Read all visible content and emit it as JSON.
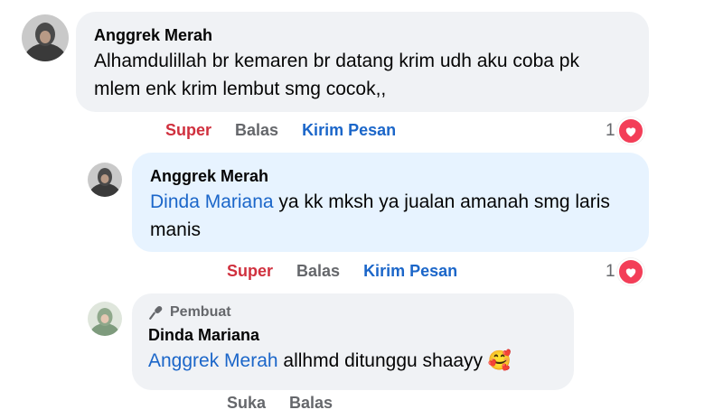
{
  "comments": [
    {
      "author": "Anggrek Merah",
      "text": "Alhamdulillah br kemaren br datang krim udh aku coba pk mlem enk krim lembut smg cocok,,",
      "actions": {
        "react": "Super",
        "reply": "Balas",
        "message": "Kirim Pesan"
      },
      "reaction_count": "1"
    },
    {
      "author": "Anggrek Merah",
      "mention": "Dinda Mariana",
      "text": " ya kk mksh ya jualan amanah smg laris manis",
      "actions": {
        "react": "Super",
        "reply": "Balas",
        "message": "Kirim Pesan"
      },
      "reaction_count": "1"
    },
    {
      "badge": "Pembuat",
      "author": "Dinda Mariana",
      "mention": "Anggrek Merah",
      "text": " allhmd ditunggu shaayy",
      "emoji": "🥰",
      "actions": {
        "react": "Suka",
        "reply": "Balas"
      }
    }
  ],
  "colors": {
    "bubble_gray": "#f0f2f5",
    "bubble_blue": "#e7f3ff",
    "super_red": "#d0303e",
    "link_blue": "#1b66c9",
    "heart": "#f33e58"
  }
}
